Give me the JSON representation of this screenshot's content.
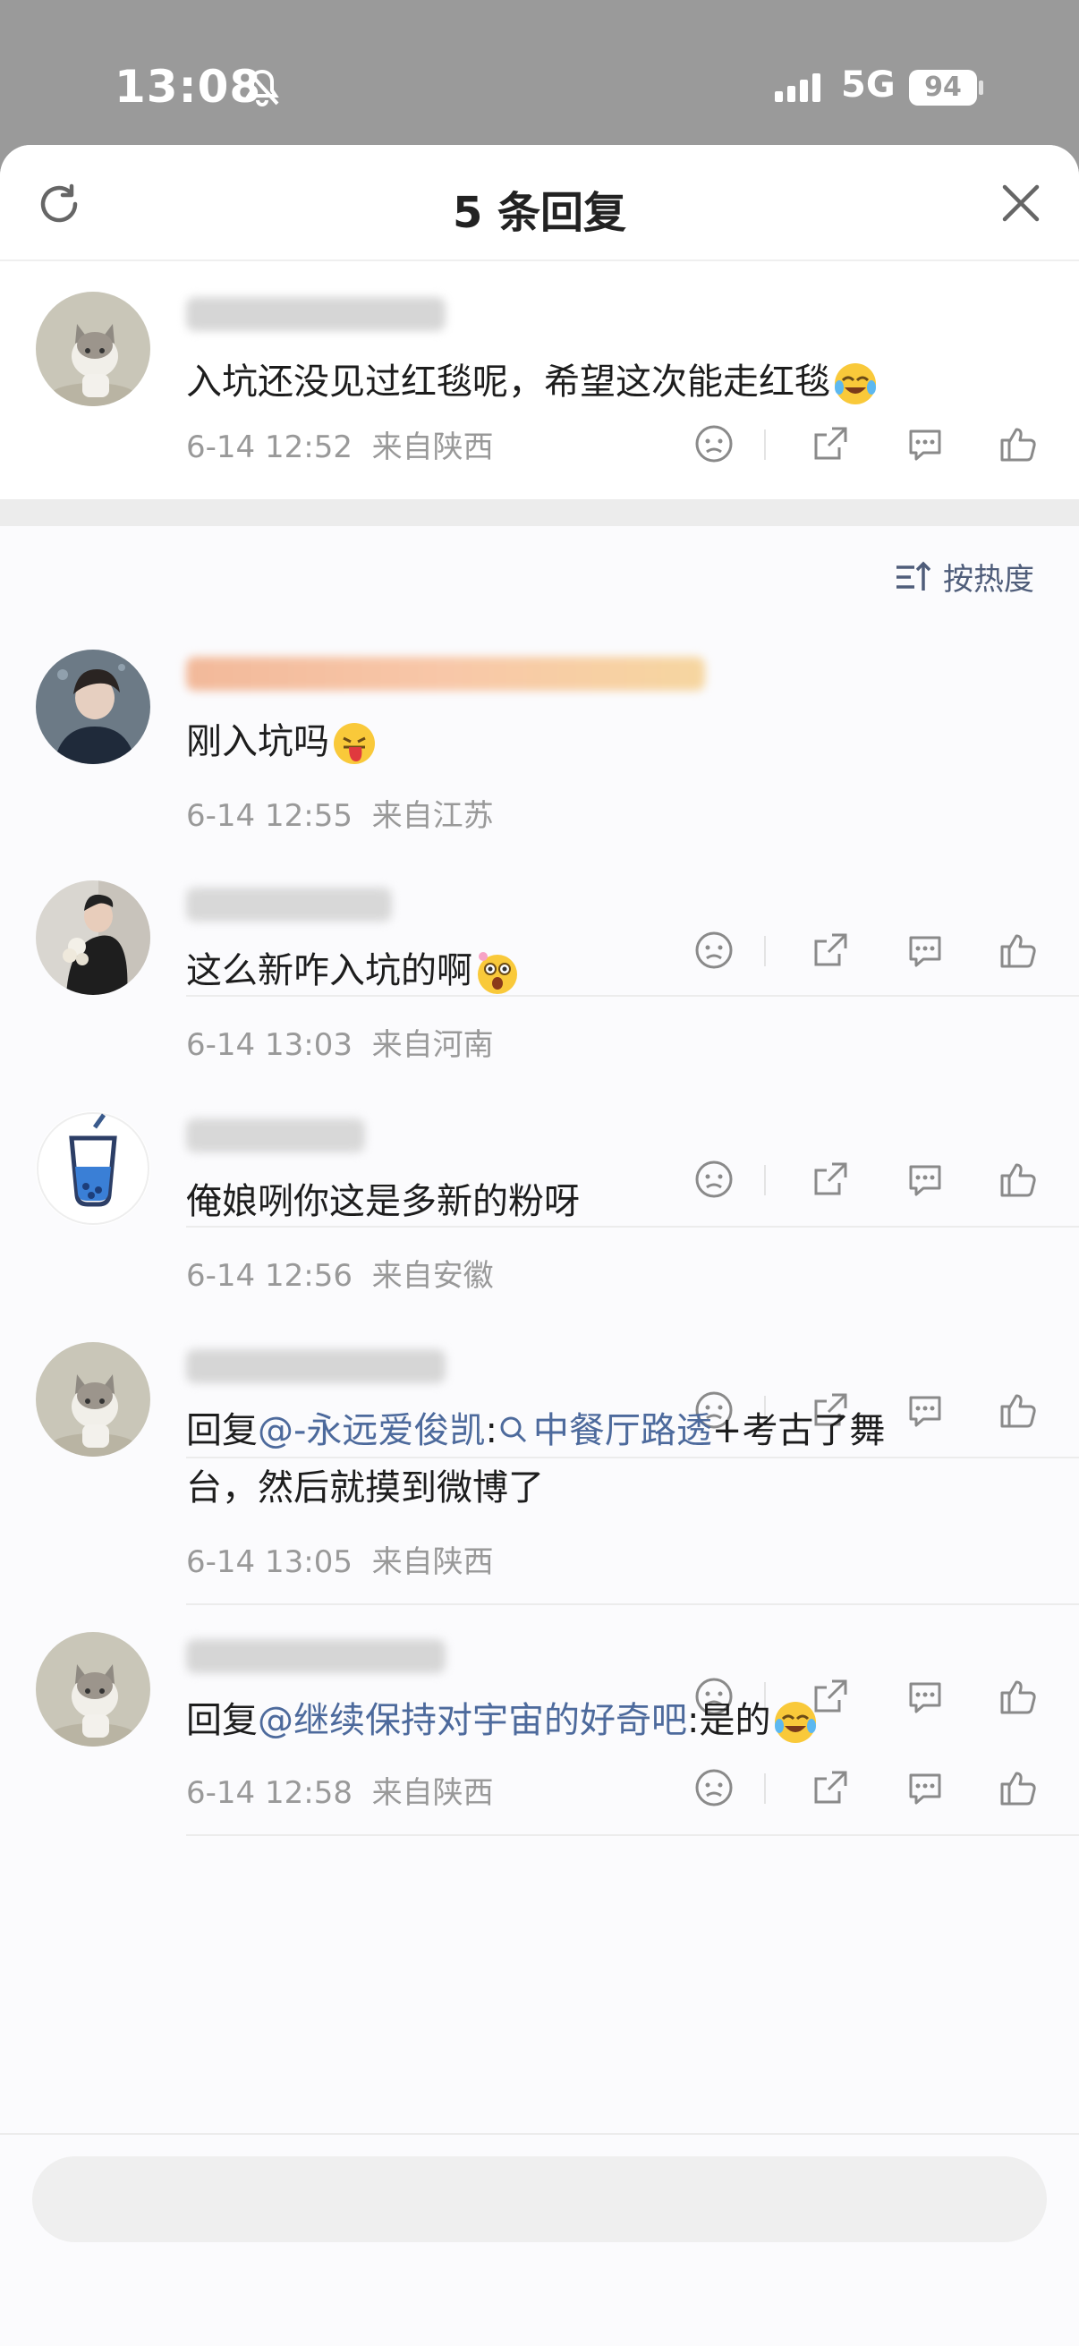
{
  "status_bar": {
    "time": "13:08",
    "network": "5G",
    "battery": "94"
  },
  "header": {
    "title": "5 条回复",
    "refresh_icon": "refresh-icon",
    "close_icon": "close-icon"
  },
  "main_comment": {
    "text": "入坑还没见过红毯呢，希望这次能走红毯",
    "time": "6-14 12:52",
    "location": "来自陕西"
  },
  "sort": {
    "label": "按热度"
  },
  "replies": [
    {
      "text": "刚入坑吗",
      "time": "6-14 12:55",
      "location": "来自江苏"
    },
    {
      "text": "这么新咋入坑的啊",
      "time": "6-14 13:03",
      "location": "来自河南"
    },
    {
      "text": "俺娘咧你这是多新的粉呀",
      "time": "6-14 12:56",
      "location": "来自安徽"
    },
    {
      "prefix": "回复",
      "mention": "@-永远爱俊凯",
      "colon": ":",
      "topic": "中餐厅路透",
      "rest_line1": "+考古了舞",
      "line2": "台，然后就摸到微博了",
      "time": "6-14 13:05",
      "location": "来自陕西"
    },
    {
      "prefix": "回复",
      "mention": "@继续保持对宇宙的好奇吧",
      "rest": ":是的",
      "time": "6-14 12:58",
      "location": "来自陕西"
    }
  ],
  "colors": {
    "mention": "#4d6a9c",
    "meta": "#999999",
    "text": "#1d1d1d"
  }
}
